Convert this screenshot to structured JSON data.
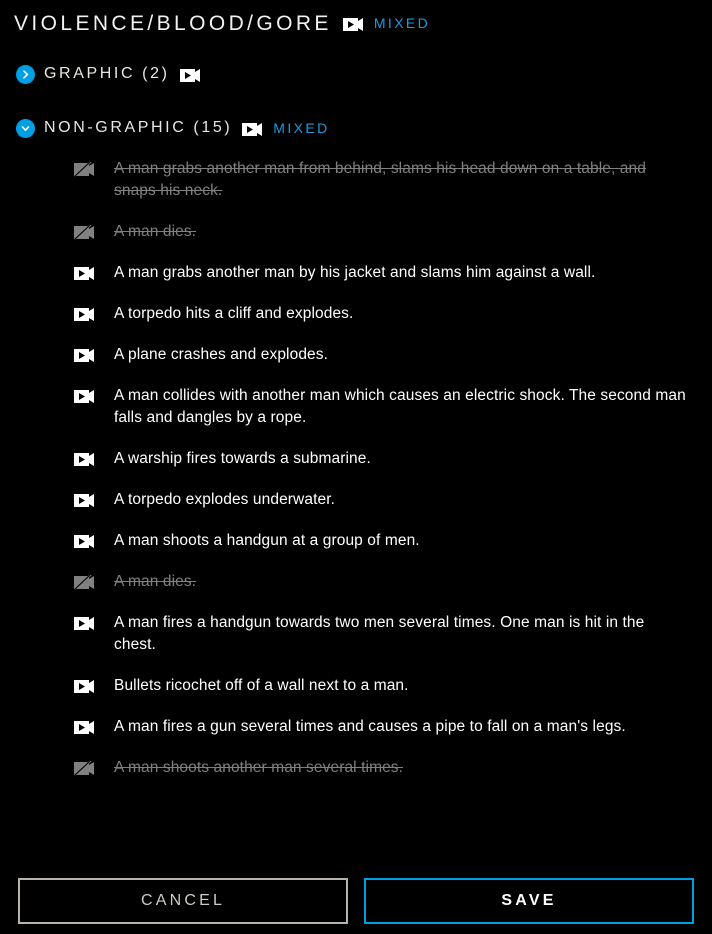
{
  "header": {
    "title": "VIOLENCE/BLOOD/GORE",
    "video_icon": "video-icon",
    "badge": "MIXED"
  },
  "sections": [
    {
      "id": "graphic",
      "label": "GRAPHIC (2)",
      "name": "GRAPHIC",
      "count": "(2)",
      "expanded": false,
      "toggle_icon": "chevron-right-icon",
      "video_icon": "video-icon",
      "badge": ""
    },
    {
      "id": "non-graphic",
      "label": "NON-GRAPHIC (15)",
      "name": "NON-GRAPHIC",
      "count": "(15)",
      "expanded": true,
      "toggle_icon": "chevron-down-icon",
      "video_icon": "video-icon",
      "badge": "MIXED"
    }
  ],
  "items": [
    {
      "text": "A man grabs another man from behind, slams his head down on a table, and snaps his neck.",
      "disabled": true,
      "icon": "video-off-icon"
    },
    {
      "text": "A man dies.",
      "disabled": true,
      "icon": "video-off-icon"
    },
    {
      "text": "A man grabs another man by his jacket and slams him against a wall.",
      "disabled": false,
      "icon": "video-icon"
    },
    {
      "text": "A torpedo hits a cliff and explodes.",
      "disabled": false,
      "icon": "video-icon"
    },
    {
      "text": "A plane crashes and explodes.",
      "disabled": false,
      "icon": "video-icon"
    },
    {
      "text": "A man collides with another man which causes an electric shock. The second man falls and dangles by a rope.",
      "disabled": false,
      "icon": "video-icon"
    },
    {
      "text": "A warship fires towards a submarine.",
      "disabled": false,
      "icon": "video-icon"
    },
    {
      "text": "A torpedo explodes underwater.",
      "disabled": false,
      "icon": "video-icon"
    },
    {
      "text": "A man shoots a handgun at a group of men.",
      "disabled": false,
      "icon": "video-icon"
    },
    {
      "text": "A man dies.",
      "disabled": true,
      "icon": "video-off-icon"
    },
    {
      "text": "A man fires a handgun towards two men several times. One man is hit in the chest.",
      "disabled": false,
      "icon": "video-icon"
    },
    {
      "text": "Bullets ricochet off of a wall next to a man.",
      "disabled": false,
      "icon": "video-icon"
    },
    {
      "text": "A man fires a gun several times and causes a pipe to fall on a man's legs.",
      "disabled": false,
      "icon": "video-icon"
    },
    {
      "text": "A man shoots another man several times.",
      "disabled": true,
      "icon": "video-off-icon"
    }
  ],
  "actions": {
    "cancel_label": "CANCEL",
    "save_label": "SAVE"
  },
  "colors": {
    "background": "#000000",
    "accent": "#009fe3",
    "text": "#ffffff",
    "disabled_text": "#808080",
    "cancel_border": "#b9b2a8"
  }
}
